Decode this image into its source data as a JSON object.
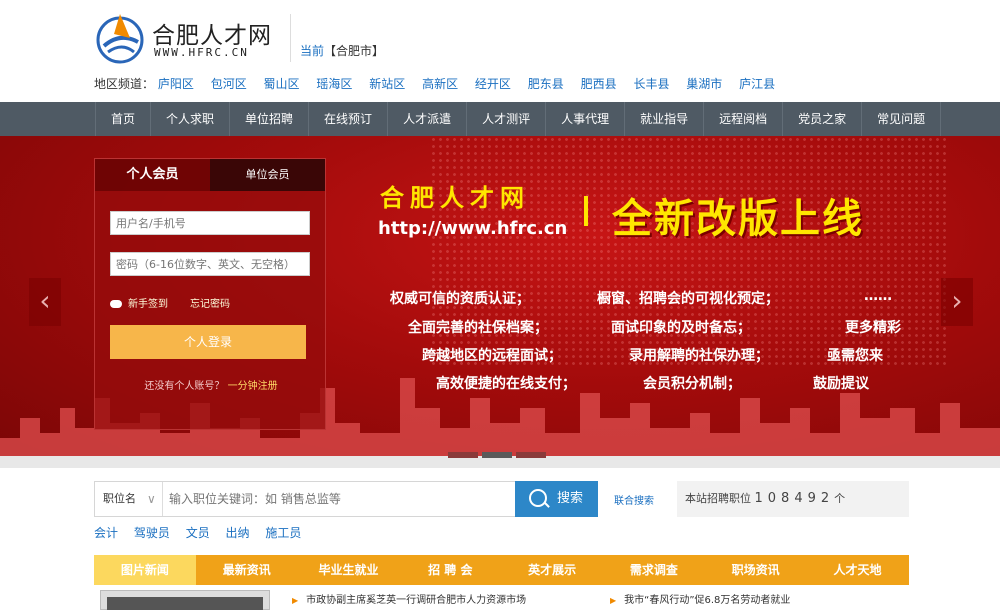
{
  "header": {
    "site_name": "合肥人才网",
    "site_url": "WWW.HFRC.CN",
    "city_label": "当前",
    "city_value": "【合肥市】",
    "region_label": "地区频道：",
    "regions": [
      "庐阳区",
      "包河区",
      "蜀山区",
      "瑶海区",
      "新站区",
      "高新区",
      "经开区",
      "肥东县",
      "肥西县",
      "长丰县",
      "巢湖市",
      "庐江县"
    ]
  },
  "nav": {
    "items": [
      "首页",
      "个人求职",
      "单位招聘",
      "在线预订",
      "人才派遣",
      "人才测评",
      "人事代理",
      "就业指导",
      "远程阅档",
      "党员之家",
      "常见问题"
    ]
  },
  "banner": {
    "title": "合肥人才网",
    "url": "http://www.hfrc.cn",
    "slogan": "全新改版上线",
    "features": {
      "col1": [
        "权威可信的资质认证；",
        "全面完善的社保档案；",
        "跨越地区的远程面试；",
        "高效便捷的在线支付；"
      ],
      "col2": [
        "橱窗、招聘会的可视化预定；",
        "面试印象的及时备忘；",
        "录用解聘的社保办理；",
        "会员积分机制；"
      ],
      "col3": [
        "……",
        "更多精彩",
        "亟需您来",
        "鼓励提议"
      ]
    },
    "prev_arrow": "‹",
    "next_arrow": "›"
  },
  "login": {
    "tab_personal": "个人会员",
    "tab_company": "单位会员",
    "username_placeholder": "用户名/手机号",
    "password_placeholder": "密码（6-16位数字、英文、无空格）",
    "signup_guide": "新手签到",
    "forgot_password": "忘记密码",
    "login_button": "个人登录",
    "no_account": "还没有个人账号？",
    "register_link": "一分钟注册"
  },
  "search": {
    "category": "职位名",
    "placeholder": "输入职位关键词：如 销售总监等",
    "button": "搜索",
    "union_search": "联合搜索",
    "count_label": "本站招聘职位",
    "count_value": "108492",
    "count_unit": "个",
    "hot_keywords": [
      "会计",
      "驾驶员",
      "文员",
      "出纳",
      "施工员"
    ]
  },
  "news": {
    "tabs": [
      "图片新闻",
      "最新资讯",
      "毕业生就业",
      "招 聘 会",
      "英才展示",
      "需求调查",
      "职场资讯",
      "人才天地"
    ],
    "active_tab": 0,
    "headline_left": "市政协副主席奚芝英一行调研合肥市人力资源市场",
    "headline_right": "我市“春风行动”促6.8万名劳动者就业"
  },
  "colors": {
    "nav_bg": "#4f5a64",
    "banner_red": "#a30b0b",
    "accent_yellow": "#ffe600",
    "link_blue": "#1a6fc0",
    "tab_orange": "#f0a218",
    "search_blue": "#2d87c8"
  }
}
